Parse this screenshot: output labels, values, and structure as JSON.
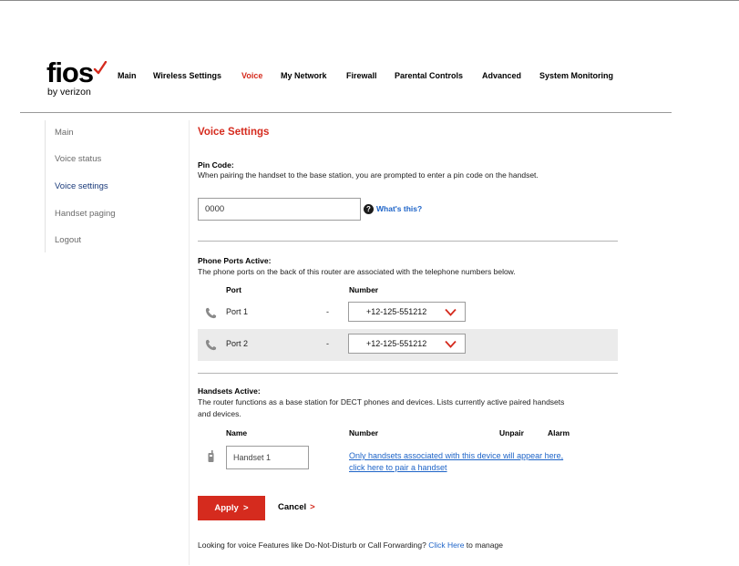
{
  "brand": {
    "logo_word": "fios",
    "logo_by": "by verizon",
    "accent_color": "#d52b1e",
    "link_color": "#1e64c8"
  },
  "nav": {
    "items": [
      {
        "label": "Main",
        "active": false
      },
      {
        "label": "Wireless Settings",
        "active": false
      },
      {
        "label": "Voice",
        "active": true
      },
      {
        "label": "My Network",
        "active": false
      },
      {
        "label": "Firewall",
        "active": false
      },
      {
        "label": "Parental Controls",
        "active": false
      },
      {
        "label": "Advanced",
        "active": false
      },
      {
        "label": "System Monitoring",
        "active": false
      }
    ]
  },
  "sidebar": {
    "items": [
      {
        "label": "Main",
        "active": false
      },
      {
        "label": "Voice status",
        "active": false
      },
      {
        "label": "Voice settings",
        "active": true
      },
      {
        "label": "Handset paging",
        "active": false
      },
      {
        "label": "Logout",
        "active": false
      }
    ]
  },
  "page": {
    "title": "Voice Settings"
  },
  "pin": {
    "label": "Pin Code:",
    "description": "When pairing the handset to the base station, you are prompted to enter a pin code on the handset.",
    "value": "0000",
    "help_icon": "question-circle-icon",
    "help_text": "What's this?"
  },
  "phone_ports": {
    "label": "Phone Ports Active:",
    "description": "The phone ports on the back of this router are associated with the telephone numbers below.",
    "col_port": "Port",
    "col_number": "Number",
    "rows": [
      {
        "icon": "phone-icon",
        "port": "Port 1",
        "dash": "-",
        "number": "+12-125-551212",
        "chevron": "chevron-down-icon"
      },
      {
        "icon": "phone-icon",
        "port": "Port 2",
        "dash": "-",
        "number": "+12-125-551212",
        "chevron": "chevron-down-icon"
      }
    ]
  },
  "handsets": {
    "label": "Handsets Active:",
    "description_line1": "The router functions as a base station for DECT phones and devices. Lists currently active paired handsets",
    "description_line2": "and devices.",
    "col_name": "Name",
    "col_number": "Number",
    "col_unpair": "Unpair",
    "col_alarm": "Alarm",
    "handset_icon": "handset-icon",
    "handset_value": "Handset 1",
    "link_line1": "Only handsets associated with this device will appear here,",
    "link_line2": "click here to pair a handset"
  },
  "actions": {
    "apply_label": "Apply",
    "apply_arrow": ">",
    "cancel_label": "Cancel",
    "cancel_arrow": ">"
  },
  "footer": {
    "text_before": "Looking for voice Features like Do-Not-Disturb or Call Forwarding? ",
    "link_text": "Click Here",
    "text_after": " to manage"
  }
}
